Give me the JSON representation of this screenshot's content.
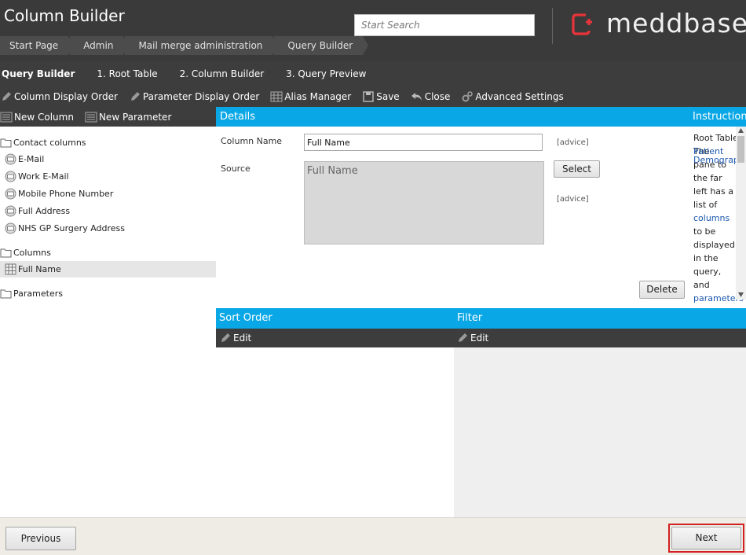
{
  "app": {
    "title": "Column Builder"
  },
  "breadcrumb": [
    "Start Page",
    "Admin",
    "Mail merge administration",
    "Query Builder"
  ],
  "search": {
    "placeholder": "Start Search",
    "value": ""
  },
  "brand": {
    "name": "meddbase",
    "accent": "#e8343a"
  },
  "tabs": [
    "Query Builder",
    "1. Root Table",
    "2. Column Builder",
    "3. Query Preview"
  ],
  "toolbar": {
    "column_display_order": "Column Display Order",
    "parameter_display_order": "Parameter Display Order",
    "alias_manager": "Alias Manager",
    "save": "Save",
    "close": "Close",
    "advanced_settings": "Advanced Settings"
  },
  "left_toolbar": {
    "new_column": "New Column",
    "new_parameter": "New Parameter"
  },
  "tree": {
    "contact_columns": "Contact columns",
    "contact_items": [
      "E-Mail",
      "Work E-Mail",
      "Mobile Phone Number",
      "Full Address",
      "NHS GP Surgery Address"
    ],
    "columns": "Columns",
    "column_items": [
      "Full Name"
    ],
    "parameters": "Parameters"
  },
  "details": {
    "heading": "Details",
    "column_name_label": "Column Name",
    "column_name_value": "Full Name",
    "source_label": "Source",
    "source_value": "Full Name",
    "advice_1": "[advice]",
    "advice_2": "[advice]",
    "select_button": "Select",
    "delete_button": "Delete"
  },
  "instructions": {
    "heading": "Instructions",
    "lines": [
      "Root Table",
      "The",
      "pane to",
      "the far",
      "left has a",
      "list of",
      "columns",
      "to be",
      "displayed",
      "in the",
      "query,",
      "and",
      "parameters"
    ],
    "links": [
      "Patient",
      "Demographics"
    ]
  },
  "sort": {
    "heading": "Sort Order",
    "edit": "Edit"
  },
  "filter": {
    "heading": "Filter",
    "edit": "Edit"
  },
  "footer": {
    "previous": "Previous",
    "next": "Next"
  },
  "colors": {
    "section_blue": "#0aa7e6",
    "dark_bar": "#3d3d3d",
    "highlight_red": "#d02020"
  }
}
